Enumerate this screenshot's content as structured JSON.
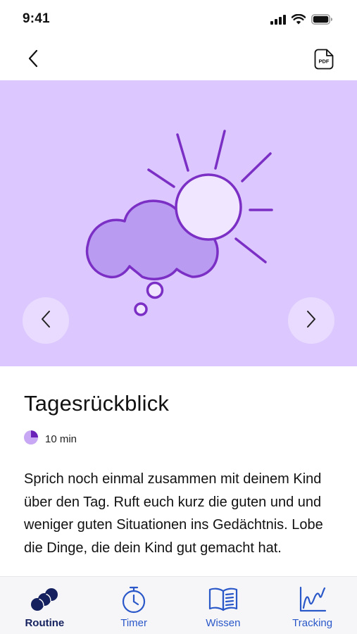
{
  "status_bar": {
    "time": "9:41"
  },
  "nav": {
    "pdf_label": "PDF"
  },
  "hero": {
    "background": "#dcc8ff",
    "accent": "#7b2fc5"
  },
  "content": {
    "title": "Tagesrückblick",
    "duration": "10 min",
    "duration_fraction": 0.25,
    "description": "Sprich noch einmal zusammen mit deinem Kind über den Tag. Ruft euch kurz die guten und und weniger guten Situationen ins Gedächtnis. Lobe die Dinge, die dein Kind gut gemacht hat."
  },
  "tab_bar": {
    "tabs": [
      {
        "label": "Routine",
        "icon": "routine-icon",
        "active": true
      },
      {
        "label": "Timer",
        "icon": "stopwatch-icon",
        "active": false
      },
      {
        "label": "Wissen",
        "icon": "book-icon",
        "active": false
      },
      {
        "label": "Tracking",
        "icon": "chart-icon",
        "active": false
      }
    ]
  },
  "colors": {
    "tab_active": "#14215e",
    "tab_inactive": "#2a58c9",
    "hero_background": "#dcc8ff"
  }
}
